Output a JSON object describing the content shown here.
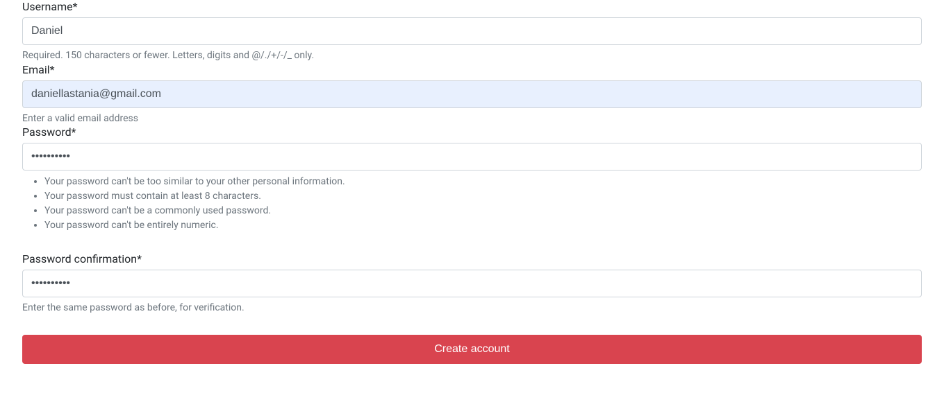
{
  "form": {
    "username": {
      "label": "Username*",
      "value": "Daniel",
      "help": "Required. 150 characters or fewer. Letters, digits and @/./+/-/_ only."
    },
    "email": {
      "label": "Email*",
      "value": "daniellastania@gmail.com",
      "help": "Enter a valid email address"
    },
    "password": {
      "label": "Password*",
      "value": "••••••••••",
      "help_items": [
        "Your password can't be too similar to your other personal information.",
        "Your password must contain at least 8 characters.",
        "Your password can't be a commonly used password.",
        "Your password can't be entirely numeric."
      ]
    },
    "password_confirm": {
      "label": "Password confirmation*",
      "value": "••••••••••",
      "help": "Enter the same password as before, for verification."
    },
    "submit_label": "Create account"
  }
}
